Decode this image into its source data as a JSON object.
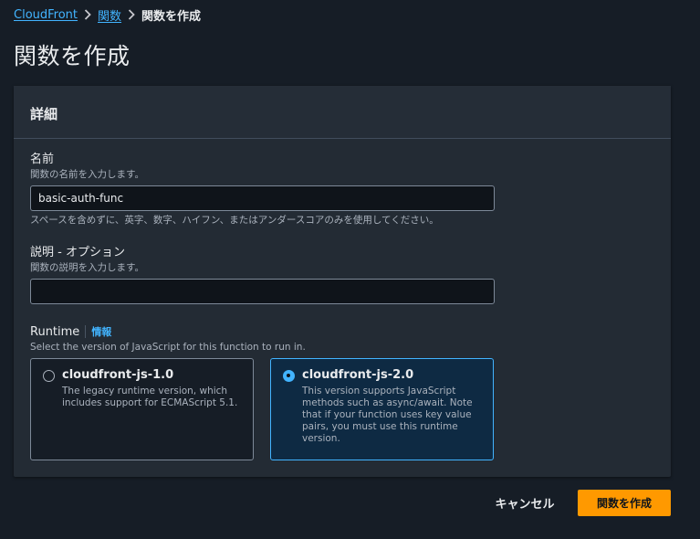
{
  "breadcrumb": {
    "items": [
      {
        "label": "CloudFront"
      },
      {
        "label": "関数"
      },
      {
        "label": "関数を作成"
      }
    ]
  },
  "page": {
    "title": "関数を作成"
  },
  "details": {
    "title": "詳細",
    "name": {
      "label": "名前",
      "description": "関数の名前を入力します。",
      "value": "basic-auth-func",
      "hint": "スペースを含めずに、英字、数字、ハイフン、またはアンダースコアのみを使用してください。"
    },
    "description": {
      "label": "説明 - オプション",
      "description": "関数の説明を入力します。",
      "value": ""
    },
    "runtime": {
      "label": "Runtime",
      "info_link": "情報",
      "description": "Select the version of JavaScript for this function to run in.",
      "options": [
        {
          "title": "cloudfront-js-1.0",
          "description": "The legacy runtime version, which includes support for ECMAScript 5.1.",
          "selected": false
        },
        {
          "title": "cloudfront-js-2.0",
          "description": "This version supports JavaScript methods such as async/await. Note that if your function uses key value pairs, you must use this runtime version.",
          "selected": true
        }
      ]
    }
  },
  "actions": {
    "cancel_label": "キャンセル",
    "create_label": "関数を作成"
  },
  "colors": {
    "background": "#161d26",
    "panel": "#232b34",
    "link": "#42b4ff",
    "primary_button": "#ff9900",
    "selected_tile": "#0e2a43"
  }
}
